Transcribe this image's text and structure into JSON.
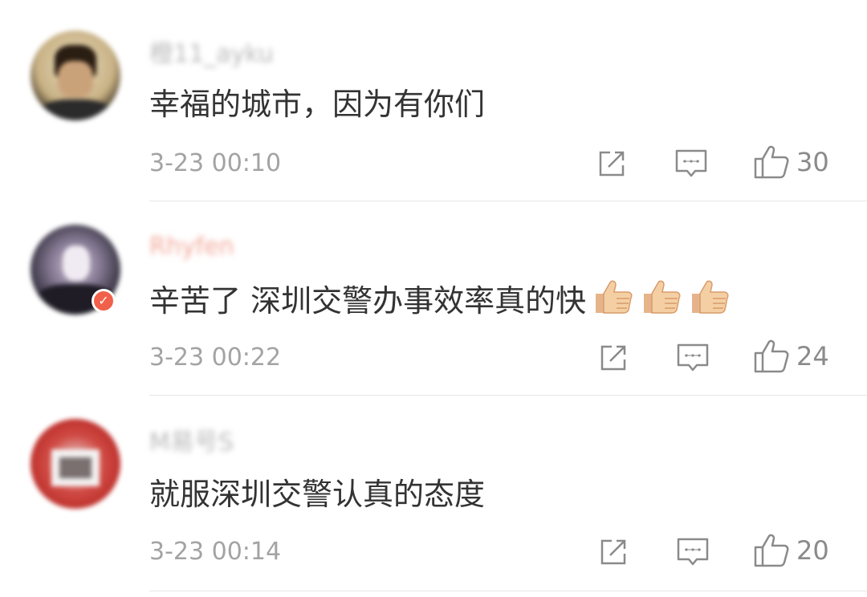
{
  "comments": [
    {
      "username": "橙11_ayku",
      "text": "幸福的城市，因为有你们",
      "time": "3-23 00:10",
      "likes": "30",
      "avatar_colors": [
        "#d8c9a0",
        "#3a2a1a"
      ]
    },
    {
      "username": "Rhyfen",
      "text": "辛苦了 深圳交警办事效率真的快",
      "emoji": [
        "thumbs-up",
        "thumbs-up",
        "thumbs-up"
      ],
      "time": "3-23 00:22",
      "likes": "24",
      "avatar_colors": [
        "#3b3a48",
        "#e8e4ec"
      ]
    },
    {
      "username": "M易号S",
      "text": "就服深圳交警认真的态度",
      "time": "3-23 00:14",
      "likes": "20",
      "avatar_colors": [
        "#c9302c",
        "#ffffff"
      ]
    }
  ],
  "icons": {
    "share": "share-icon",
    "reply": "comment-icon",
    "like": "thumbs-up-icon"
  }
}
